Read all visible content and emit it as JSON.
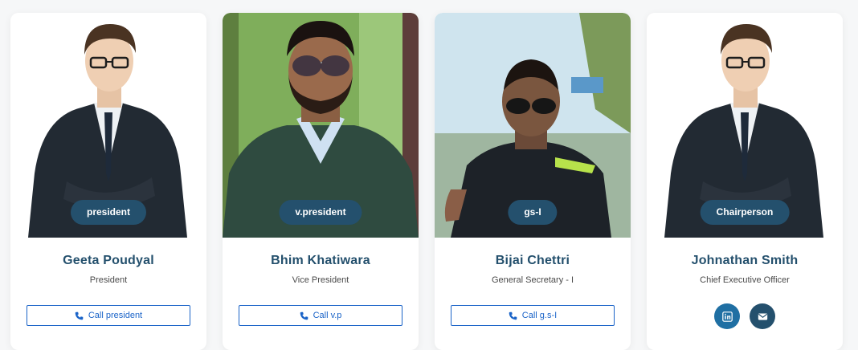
{
  "members": [
    {
      "badge": "president",
      "name": "Geeta Poudyal",
      "title": "President",
      "call_label": "Call president"
    },
    {
      "badge": "v.president",
      "name": "Bhim Khatiwara",
      "title": "Vice President",
      "call_label": "Call v.p"
    },
    {
      "badge": "gs-I",
      "name": "Bijai Chettri",
      "title": "General Secretary - I",
      "call_label": "Call g.s-I"
    },
    {
      "badge": "Chairperson",
      "name": "Johnathan Smith",
      "title": "Chief Executive Officer",
      "social": [
        "linkedin-icon",
        "envelope-icon"
      ]
    }
  ],
  "colors": {
    "accent": "#24506d",
    "link": "#1b64c8",
    "linkedin": "#1f6fa3"
  }
}
